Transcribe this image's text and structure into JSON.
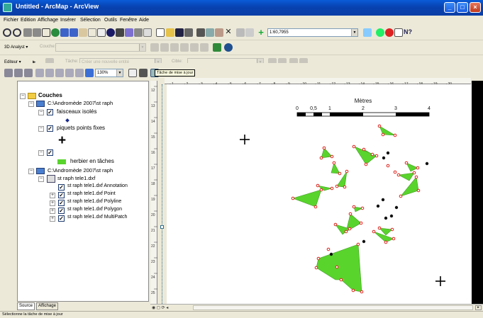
{
  "window": {
    "title": "Untitled - ArcMap - ArcView",
    "controls": [
      "_",
      "□",
      "×"
    ]
  },
  "menubar": {
    "items": [
      "Fichier",
      "Edition",
      "Affichage",
      "Insérer",
      "Sélection",
      "Outils",
      "Fenêtre",
      "Aide"
    ]
  },
  "standard_toolbar": {
    "scale_value": "1:60,7955"
  },
  "analyst_toolbar": {
    "label": "3D Analyst ▾",
    "layer_label": "Couche:"
  },
  "editor_toolbar": {
    "menu_label": "Editeur ▾",
    "task_label": "Tâche:",
    "task_value": "Créer une nouvelle entité",
    "target_label": "Cible:"
  },
  "layout_toolbar": {
    "zoom_value": "130%",
    "tooltip": "Tâche de mise à jour"
  },
  "toc": {
    "root": "Couches",
    "group1": "C:\\Andromède 2007\\st raph",
    "layer1": "faisceaux isolés",
    "layer2": "piquets points fixes",
    "layer3_label": "herbier en tâches",
    "group2": "C:\\Andromède 2007\\st raph",
    "dxf": "st raph tele1.dxf",
    "sublayers": [
      "st raph tele1.dxf Annotation",
      "st raph tele1.dxf Point",
      "st raph tele1.dxf Polyline",
      "st raph tele1.dxf Polygon",
      "st raph tele1.dxf MultiPatch"
    ]
  },
  "tabs": {
    "source": "Source",
    "display": "Affichage"
  },
  "status": {
    "text": "Sélectionne la tâche de mise à jour"
  },
  "ruler": {
    "top_ticks": [
      "1",
      "2",
      "3",
      "4",
      "5",
      "6",
      "7",
      "8",
      "9",
      "10",
      "11",
      "12",
      "13",
      "14",
      "15",
      "16",
      "17",
      "18",
      "19",
      "20"
    ],
    "left_ticks": [
      "12",
      "13",
      "14",
      "15",
      "16",
      "17",
      "18",
      "19",
      "20",
      "21",
      "22",
      "23",
      "24",
      "25"
    ]
  },
  "map": {
    "scalebar_title": "Mètres",
    "scalebar_labels": [
      "0",
      "0,5",
      "1",
      "2",
      "3",
      "4"
    ]
  },
  "colors": {
    "herbier": "#59d42d",
    "point_red": "#e0201a",
    "point_black": "#111111"
  }
}
